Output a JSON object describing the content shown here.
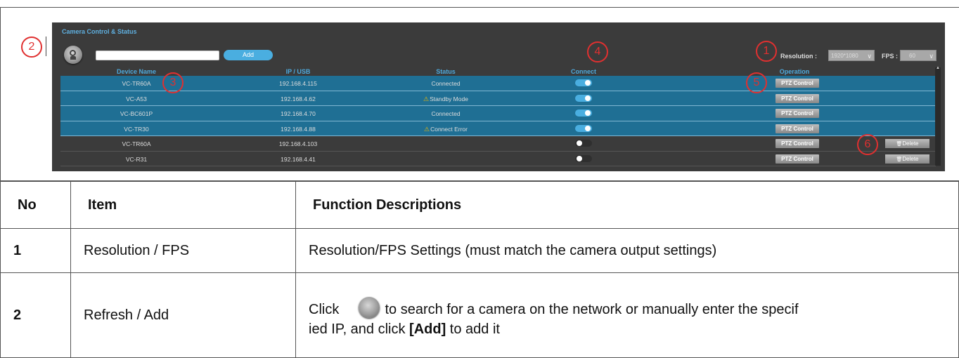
{
  "panel": {
    "title": "Camera Control & Status",
    "add_label": "Add",
    "resolution_label": "Resolution :",
    "resolution_value": "1920*1080",
    "fps_label": "FPS :",
    "fps_value": "60",
    "columns": [
      "Device Name",
      "IP / USB",
      "Status",
      "Connect",
      "Operation"
    ],
    "rows": [
      {
        "name": "VC-TR60A",
        "ip": "192.168.4.115",
        "status": "Connected",
        "warn": false,
        "connected": true,
        "selected": true,
        "ptz": "PTZ Control",
        "delete": ""
      },
      {
        "name": "VC-A53",
        "ip": "192.168.4.62",
        "status": "Standby Mode",
        "warn": true,
        "connected": true,
        "selected": true,
        "ptz": "PTZ Control",
        "delete": ""
      },
      {
        "name": "VC-BC601P",
        "ip": "192.168.4.70",
        "status": "Connected",
        "warn": false,
        "connected": true,
        "selected": true,
        "ptz": "PTZ Control",
        "delete": ""
      },
      {
        "name": "VC-TR30",
        "ip": "192.168.4.88",
        "status": "Connect Error",
        "warn": true,
        "connected": true,
        "selected": true,
        "ptz": "PTZ Control",
        "delete": ""
      },
      {
        "name": "VC-TR60A",
        "ip": "192.168.4.103",
        "status": "",
        "warn": false,
        "connected": false,
        "selected": false,
        "ptz": "PTZ Control",
        "delete": "Delete"
      },
      {
        "name": "VC-R31",
        "ip": "192.168.4.41",
        "status": "",
        "warn": false,
        "connected": false,
        "selected": false,
        "ptz": "PTZ Control",
        "delete": "Delete"
      }
    ]
  },
  "callouts": [
    "1",
    "2",
    "3",
    "4",
    "5",
    "6"
  ],
  "table": {
    "headers": [
      "No",
      "Item",
      "Function Descriptions"
    ],
    "rows": [
      {
        "no": "1",
        "item": "Resolution / FPS",
        "desc": "Resolution/FPS Settings (must match the camera output settings)"
      },
      {
        "no": "2",
        "item": "Refresh / Add",
        "desc_before": "Click",
        "desc_after": " to search for a camera on the network or manually enter the specif",
        "desc_line2_a": "ied IP, and click ",
        "desc_line2_bold": "[Add]",
        "desc_line2_b": " to add it"
      }
    ]
  },
  "colors": {
    "panel_bg": "#3b3b3b",
    "row_selected": "#1f6f94",
    "accent": "#4aaee0",
    "callout": "#e03030"
  }
}
